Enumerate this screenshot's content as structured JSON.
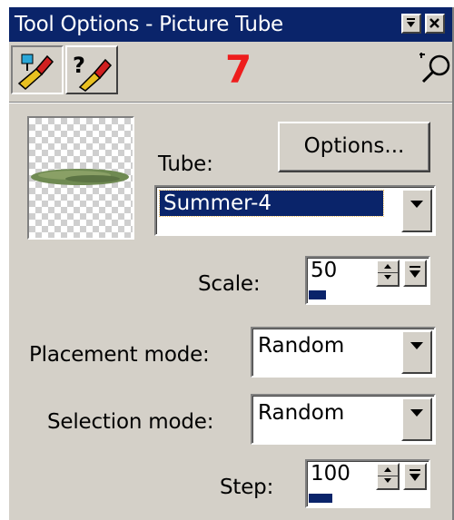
{
  "window": {
    "title": "Tool Options - Picture Tube",
    "minimize_icon": "minimize-icon",
    "close_icon": "close-icon"
  },
  "toolbar": {
    "tabs": [
      {
        "name": "tool-options-tab",
        "icon": "brush-tool-icon",
        "active": true
      },
      {
        "name": "help-tab",
        "icon": "help-brush-icon",
        "active": false
      }
    ],
    "annotation": "7",
    "annotation_color": "#ee1d1d",
    "magnify_icon": "magnifier-icon"
  },
  "tube": {
    "label": "Tube:",
    "options_button": "Options...",
    "selected": "Summer-4"
  },
  "scale": {
    "label": "Scale:",
    "value": "50",
    "level": 0.15
  },
  "placement_mode": {
    "label": "Placement mode:",
    "value": "Random"
  },
  "selection_mode": {
    "label": "Selection mode:",
    "value": "Random"
  },
  "step": {
    "label": "Step:",
    "value": "100",
    "level": 0.2
  },
  "colors": {
    "titlebar": "#0a246a",
    "face": "#d4d0c8",
    "selection": "#0a246a"
  }
}
